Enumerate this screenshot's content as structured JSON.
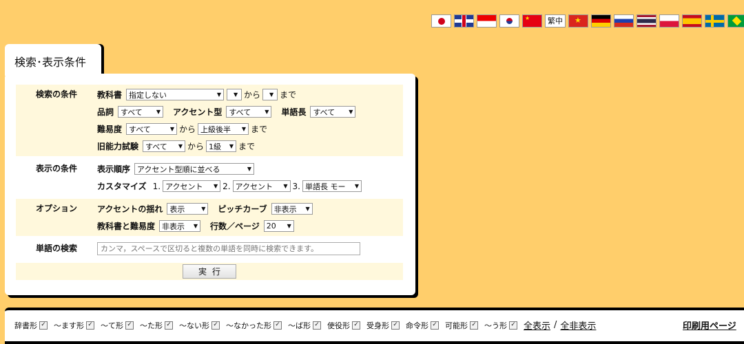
{
  "flags": [
    {
      "code": "jp",
      "name": "japan-flag-icon"
    },
    {
      "code": "uk",
      "name": "uk-flag-icon"
    },
    {
      "code": "id",
      "name": "indonesia-flag-icon"
    },
    {
      "code": "kr",
      "name": "korea-flag-icon"
    },
    {
      "code": "cn",
      "name": "china-flag-icon"
    },
    {
      "code": "text",
      "name": "traditional-chinese-link",
      "label": "繁中"
    },
    {
      "code": "vn",
      "name": "vietnam-flag-icon"
    },
    {
      "code": "de",
      "name": "germany-flag-icon"
    },
    {
      "code": "ru",
      "name": "russia-flag-icon"
    },
    {
      "code": "th",
      "name": "thailand-flag-icon"
    },
    {
      "code": "pl",
      "name": "poland-flag-icon"
    },
    {
      "code": "es",
      "name": "spain-flag-icon"
    },
    {
      "code": "se",
      "name": "sweden-flag-icon"
    },
    {
      "code": "br",
      "name": "brazil-flag-icon"
    }
  ],
  "tab": {
    "title": "検索･表示条件"
  },
  "search": {
    "label": "検索の条件",
    "textbook_label": "教科書",
    "textbook_value": "指定しない",
    "range_from_value": "",
    "kara": "から",
    "range_to_value": "",
    "made": "まで",
    "pos_label": "品詞",
    "pos_value": "すべて",
    "accent_label": "アクセント型",
    "accent_value": "すべて",
    "length_label": "単語長",
    "length_value": "すべて",
    "difficulty_label": "難易度",
    "difficulty_from": "すべて",
    "difficulty_to": "上級後半",
    "jlpt_label": "旧能力試験",
    "jlpt_from": "すべて",
    "jlpt_to": "1級"
  },
  "display": {
    "label": "表示の条件",
    "order_label": "表示順序",
    "order_value": "アクセント型順に並べる",
    "customize_label": "カスタマイズ",
    "n1": "1.",
    "c1": "アクセント",
    "n2": "2.",
    "c2": "アクセント",
    "n3": "3.",
    "c3": "単語長 モー"
  },
  "options": {
    "label": "オプション",
    "sway_label": "アクセントの揺れ",
    "sway_value": "表示",
    "pitch_label": "ピッチカーブ",
    "pitch_value": "非表示",
    "tb_diff_label": "教科書と難易度",
    "tb_diff_value": "非表示",
    "rows_label": "行数／ページ",
    "rows_value": "20"
  },
  "word_search": {
    "label": "単語の検索",
    "placeholder": "カンマ，スペースで区切ると複数の単語を同時に検索できます。"
  },
  "execute_label": "実行",
  "forms": [
    "辞書形",
    "～ます形",
    "～て形",
    "～た形",
    "～ない形",
    "～なかった形",
    "～ば形",
    "使役形",
    "受身形",
    "命令形",
    "可能形",
    "～う形"
  ],
  "check_mark": "✓",
  "show_all": "全表示",
  "separator": "/",
  "hide_all": "全非表示",
  "print_page": "印刷用ページ"
}
